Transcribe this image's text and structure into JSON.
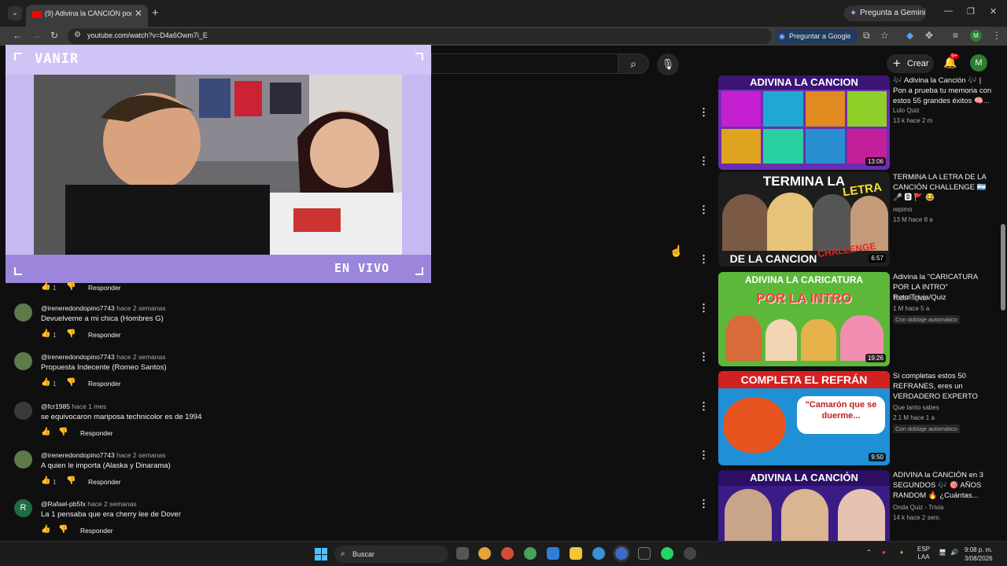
{
  "browser": {
    "tab_title": "(9) Adivina la CANCIÓN por su",
    "tab_close": "✕",
    "new_tab": "+",
    "gemini_label": "Pregunta a Gemini",
    "url": "youtube.com/watch?v=D4a6Owm7i_E",
    "ask_google": "Preguntar a Google",
    "profile_initial": "M"
  },
  "youtube": {
    "create_label": "Crear",
    "notification_count": "9+",
    "avatar_initial": "M"
  },
  "stream_overlay": {
    "streamer_name": "VANIR",
    "live_label": "EN VIVO"
  },
  "comments": {
    "partial_first": {
      "likes": "1",
      "reply": "Responder"
    },
    "items": [
      {
        "author": "@ireneredondopino7743",
        "time": "hace 2 semanas",
        "text": "Devuelveme a mi chica (Hombres G)",
        "likes": "1",
        "reply": "Responder"
      },
      {
        "author": "@ireneredondopino7743",
        "time": "hace 2 semanas",
        "text": "Propuesta Indecente (Romeo Santos)",
        "likes": "1",
        "reply": "Responder"
      },
      {
        "author": "@fcr1985",
        "time": "hace 1 mes",
        "text": "se equivocaron mariposa technicolor es de 1994",
        "likes": "",
        "reply": "Responder"
      },
      {
        "author": "@ireneredondopino7743",
        "time": "hace 2 semanas",
        "text": "A quien le importa (Alaska y Dinarama)",
        "likes": "1",
        "reply": "Responder"
      },
      {
        "author": "@Rafael-pb5fx",
        "time": "hace 2 semanas",
        "text": "La 1 pensaba que era cherry lee de Dover",
        "likes": "",
        "reply": "Responder",
        "avatar_letter": "R"
      }
    ]
  },
  "related": [
    {
      "title": "🎶 Adivina la Canción 🎶 | Pon a prueba tu memoria con estos 55 grandes éxitos 🧠...",
      "channel": "Lulo Quiz",
      "stats": "13 k  hace 2 m",
      "duration": "13:06",
      "thumb_text_1": "ADIVINA LA CANCION",
      "badge": ""
    },
    {
      "title": "TERMINA LA LETRA DE LA CANCIÓN CHALLENGE 🇦🇷 🎤 🅱 🚩 😂",
      "channel": "repimo",
      "stats": "13 M  hace 8 a",
      "duration": "6:57",
      "thumb_text_1": "TERMINA LA",
      "thumb_text_2": "LETRA",
      "thumb_text_3": "DE LA CANCION",
      "thumb_text_4": "CHALLENGE",
      "badge": ""
    },
    {
      "title": "Adivina la \"CARICATURA POR LA INTRO\" Reto/Trivia/Quiz",
      "channel": "TodoFriQuiz",
      "stats": "1 M  hace 5 a",
      "duration": "19:26",
      "thumb_text_1": "ADIVINA LA CARICATURA",
      "thumb_text_2": "POR LA INTRO",
      "badge": "Con doblaje automático"
    },
    {
      "title": "Si completas estos 50 REFRANES, eres un VERDADERO EXPERTO",
      "channel": "Que tanto sabes",
      "stats": "2.1 M  hace 1 a",
      "duration": "9:50",
      "thumb_text_1": "COMPLETA EL REFRÁN",
      "thumb_text_2": "\"Camarón que se duerme...",
      "badge": "Con doblaje automático"
    },
    {
      "title": "ADIVINA la CANCIÓN en 3 SEGUNDOS 🎶 🎯 AÑOS RANDOM 🔥 ¿Cuántas...",
      "channel": "Onda Quiz - Trivia",
      "stats": "14 k  hace 2 sem.",
      "duration": "",
      "thumb_text_1": "ADIVINA LA CANCIÓN",
      "badge": ""
    }
  ],
  "taskbar": {
    "search_label": "Buscar",
    "lang_top": "ESP",
    "lang_bottom": "LAA",
    "time": "9:08 p. m.",
    "date": "3/08/2026"
  },
  "colors": {
    "overlay_purple": "#a18de0",
    "overlay_light": "#c6b9f2",
    "youtube_bg": "#0f0f0f",
    "accent_red": "#ff0000"
  }
}
